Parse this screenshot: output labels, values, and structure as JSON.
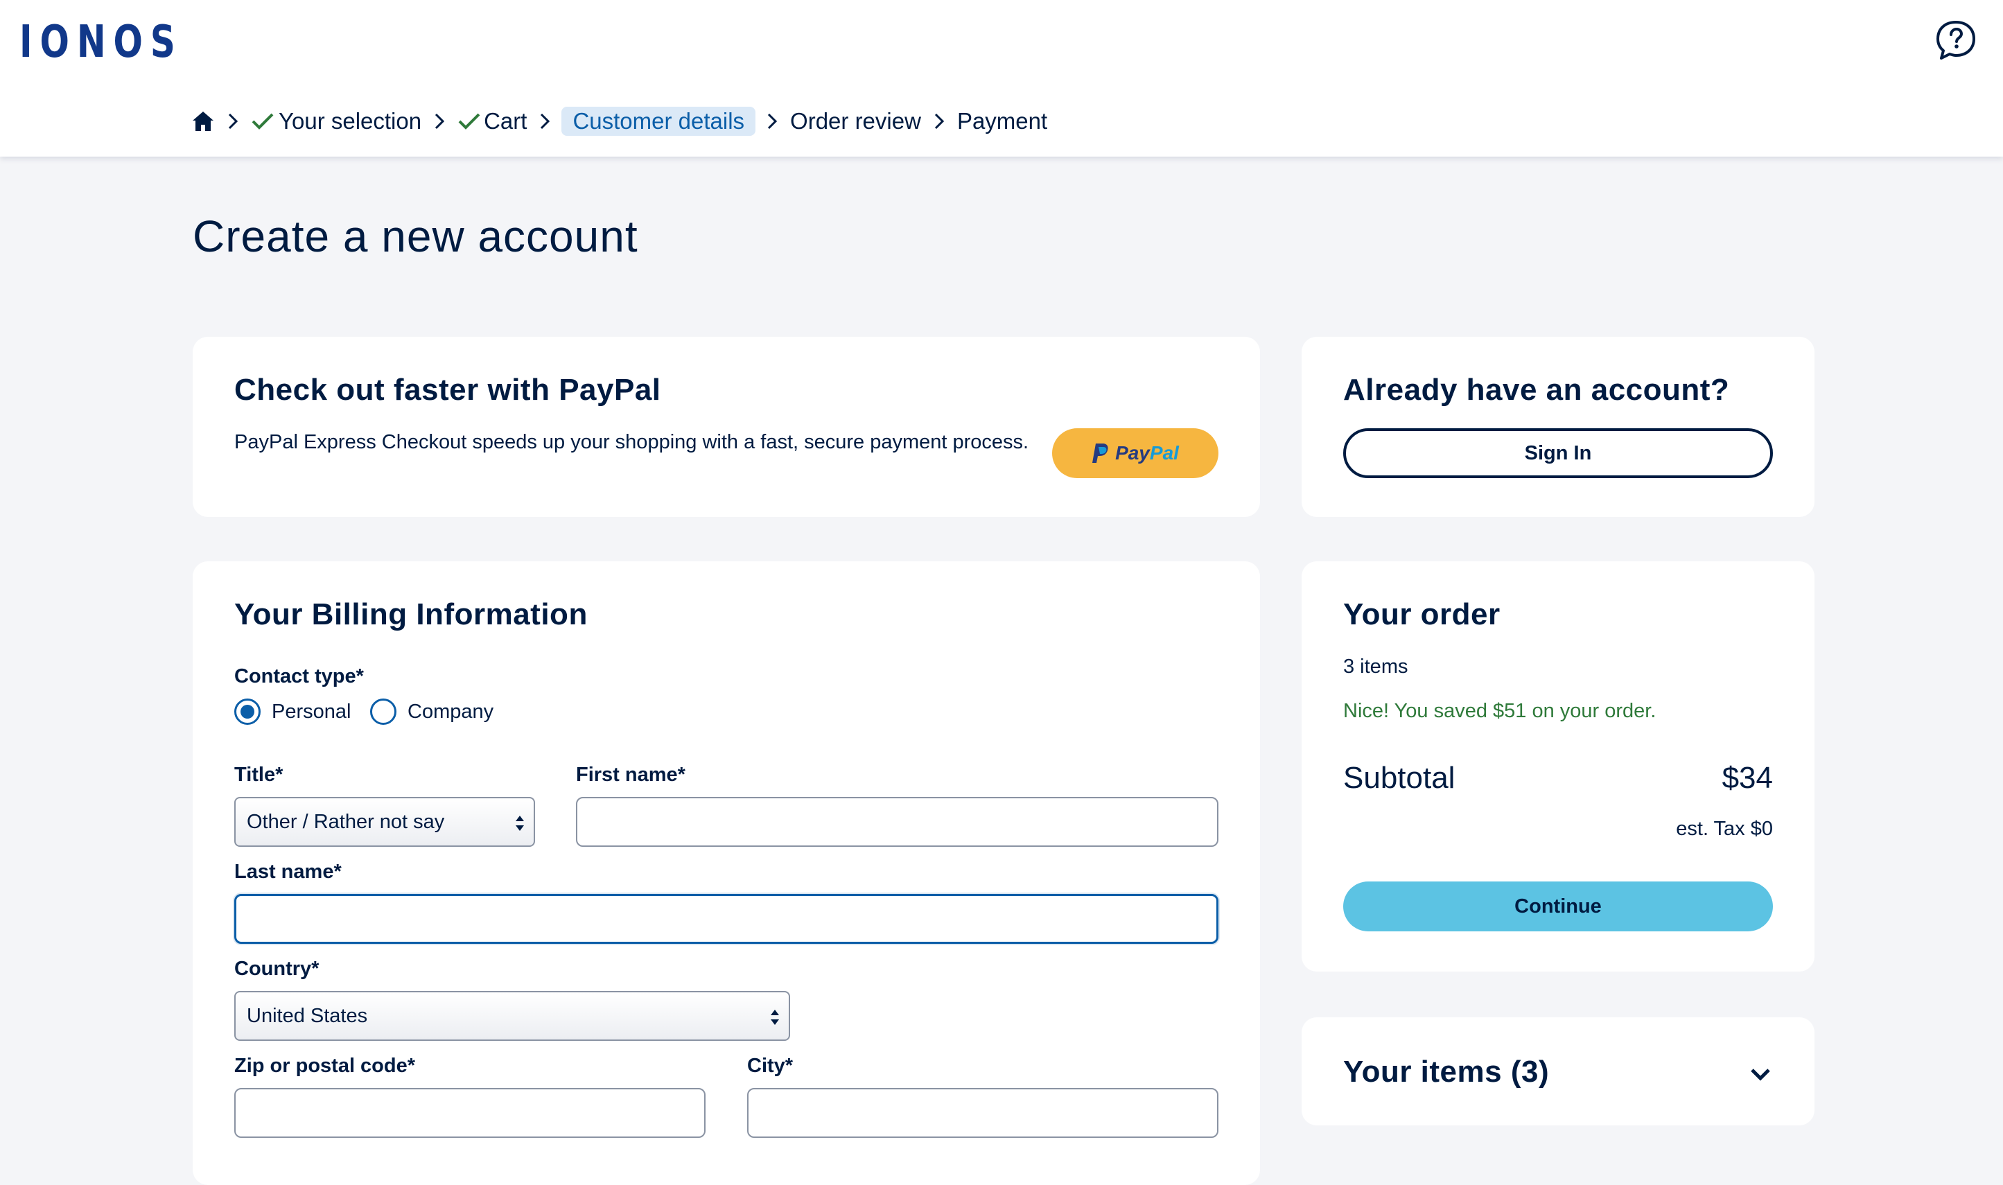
{
  "header": {
    "logo": "IONOS",
    "help_icon": "chat-question-icon"
  },
  "breadcrumb": [
    {
      "label": "",
      "icon": "home-icon",
      "done": false
    },
    {
      "label": "Your selection",
      "icon": "check-icon",
      "done": true
    },
    {
      "label": "Cart",
      "icon": "check-icon",
      "done": true
    },
    {
      "label": "Customer details",
      "active": true
    },
    {
      "label": "Order review"
    },
    {
      "label": "Payment"
    }
  ],
  "page_title": "Create a new account",
  "paypal": {
    "title": "Check out faster with PayPal",
    "text": "PayPal Express Checkout speeds up your shopping with a fast, secure payment process.",
    "button_pay": "Pay",
    "button_pal": "Pal",
    "button_color": "#f6b640"
  },
  "account": {
    "title": "Already have an account?",
    "sign_in": "Sign In"
  },
  "billing": {
    "title": "Your Billing Information",
    "contact_type_label": "Contact type*",
    "contact_options": [
      "Personal",
      "Company"
    ],
    "contact_selected": "Personal",
    "title_label": "Title*",
    "title_value": "Other / Rather not say",
    "first_name_label": "First name*",
    "first_name_value": "",
    "last_name_label": "Last name*",
    "last_name_value": "",
    "country_label": "Country*",
    "country_value": "United States",
    "zip_label": "Zip or postal code*",
    "zip_value": "",
    "city_label": "City*",
    "city_value": ""
  },
  "order": {
    "title": "Your order",
    "items_count": "3 items",
    "saved_text": "Nice! You saved $51 on your order.",
    "subtotal_label": "Subtotal",
    "subtotal_value": "$34",
    "tax_text": "est. Tax $0",
    "continue": "Continue",
    "continue_color": "#5cc3e3"
  },
  "items": {
    "title": "Your items (3)",
    "toggle_icon": "chevron-down-icon"
  },
  "colors": {
    "navy": "#001b41",
    "accent_blue": "#0b5ea8",
    "check_green": "#2f7a3a",
    "page_bg": "#f4f5f8"
  }
}
